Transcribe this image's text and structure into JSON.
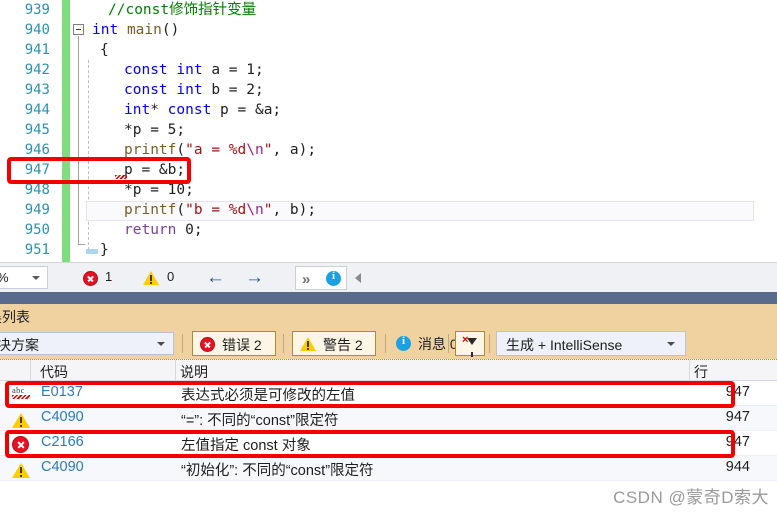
{
  "editor": {
    "lines": [
      {
        "num": "939",
        "indent": 2,
        "tokens": [
          {
            "t": "//const修饰指针变量",
            "c": "cmt"
          }
        ]
      },
      {
        "num": "940",
        "indent": 0,
        "tokens": [
          {
            "t": "int",
            "c": "kw"
          },
          {
            "t": " ",
            "c": "id"
          },
          {
            "t": "main",
            "c": "fn"
          },
          {
            "t": "()",
            "c": "id"
          }
        ]
      },
      {
        "num": "941",
        "indent": 1,
        "tokens": [
          {
            "t": "{",
            "c": "id"
          }
        ]
      },
      {
        "num": "942",
        "indent": 4,
        "tokens": [
          {
            "t": "const",
            "c": "kw"
          },
          {
            "t": " ",
            "c": "id"
          },
          {
            "t": "int",
            "c": "kw"
          },
          {
            "t": " a = ",
            "c": "id"
          },
          {
            "t": "1",
            "c": "id"
          },
          {
            "t": ";",
            "c": "id"
          }
        ]
      },
      {
        "num": "943",
        "indent": 4,
        "tokens": [
          {
            "t": "const",
            "c": "kw"
          },
          {
            "t": " ",
            "c": "id"
          },
          {
            "t": "int",
            "c": "kw"
          },
          {
            "t": " b = ",
            "c": "id"
          },
          {
            "t": "2",
            "c": "id"
          },
          {
            "t": ";",
            "c": "id"
          }
        ]
      },
      {
        "num": "944",
        "indent": 4,
        "tokens": [
          {
            "t": "int",
            "c": "kw"
          },
          {
            "t": "* ",
            "c": "id"
          },
          {
            "t": "const",
            "c": "kw"
          },
          {
            "t": " p = &a;",
            "c": "id"
          }
        ]
      },
      {
        "num": "945",
        "indent": 4,
        "tokens": [
          {
            "t": "*p = ",
            "c": "id"
          },
          {
            "t": "5",
            "c": "id"
          },
          {
            "t": ";",
            "c": "id"
          }
        ]
      },
      {
        "num": "946",
        "indent": 4,
        "tokens": [
          {
            "t": "printf",
            "c": "fn"
          },
          {
            "t": "(",
            "c": "id"
          },
          {
            "t": "\"a = %d",
            "c": "str"
          },
          {
            "t": "\\n",
            "c": "esc"
          },
          {
            "t": "\"",
            "c": "str"
          },
          {
            "t": ", a);",
            "c": "id"
          }
        ]
      },
      {
        "num": "947",
        "indent": 4,
        "tokens": [
          {
            "t": "p = &b;",
            "c": "id"
          }
        ]
      },
      {
        "num": "948",
        "indent": 4,
        "tokens": [
          {
            "t": "*p = ",
            "c": "id"
          },
          {
            "t": "10",
            "c": "id"
          },
          {
            "t": ";",
            "c": "id"
          }
        ]
      },
      {
        "num": "949",
        "indent": 4,
        "tokens": [
          {
            "t": "printf",
            "c": "fn"
          },
          {
            "t": "(",
            "c": "id"
          },
          {
            "t": "\"b = %d",
            "c": "str"
          },
          {
            "t": "\\n",
            "c": "esc"
          },
          {
            "t": "\"",
            "c": "str"
          },
          {
            "t": ", b);",
            "c": "id"
          }
        ]
      },
      {
        "num": "950",
        "indent": 4,
        "tokens": [
          {
            "t": "return",
            "c": "kw2"
          },
          {
            "t": " ",
            "c": "id"
          },
          {
            "t": "0",
            "c": "id"
          },
          {
            "t": ";",
            "c": "id"
          }
        ]
      },
      {
        "num": "951",
        "indent": 1,
        "tokens": [
          {
            "t": "}",
            "c": "id"
          }
        ]
      }
    ]
  },
  "statusbar": {
    "zoom_value": "%",
    "error_count": "1",
    "warning_count": "0",
    "back_arrow": "←",
    "forward_arrow": "→",
    "chevron": "»"
  },
  "error_panel": {
    "title": "吴列表",
    "scope_value": "个解决方案",
    "errors_label": "错误 2",
    "warnings_label": "警告 2",
    "messages_label": "消息 0",
    "build_value": "生成 + IntelliSense",
    "columns": {
      "code": "代码",
      "description": "说明",
      "line": "行"
    },
    "rows": [
      {
        "icon": "intellisense-squiggle-icon",
        "code": "E0137",
        "description": "表达式必须是可修改的左值",
        "line": "947"
      },
      {
        "icon": "warning-icon",
        "code": "C4090",
        "description": "“=”: 不同的“const”限定符",
        "line": "947"
      },
      {
        "icon": "error-icon",
        "code": "C2166",
        "description": "左值指定 const 对象",
        "line": "947"
      },
      {
        "icon": "warning-icon",
        "code": "C4090",
        "description": "“初始化”: 不同的“const”限定符",
        "line": "944"
      }
    ]
  },
  "watermark": {
    "text": "CSDN @蒙奇D索大"
  },
  "colors": {
    "accent_blue": "#2a7ac0",
    "error_red": "#e81123",
    "warning_yellow": "#ffcc00",
    "annotation_red": "#f40000",
    "panel_tan": "#f0d2a0",
    "band_blue": "#5a6a8c",
    "change_green": "#7fdd7f",
    "linenum_teal": "#2b91af"
  }
}
